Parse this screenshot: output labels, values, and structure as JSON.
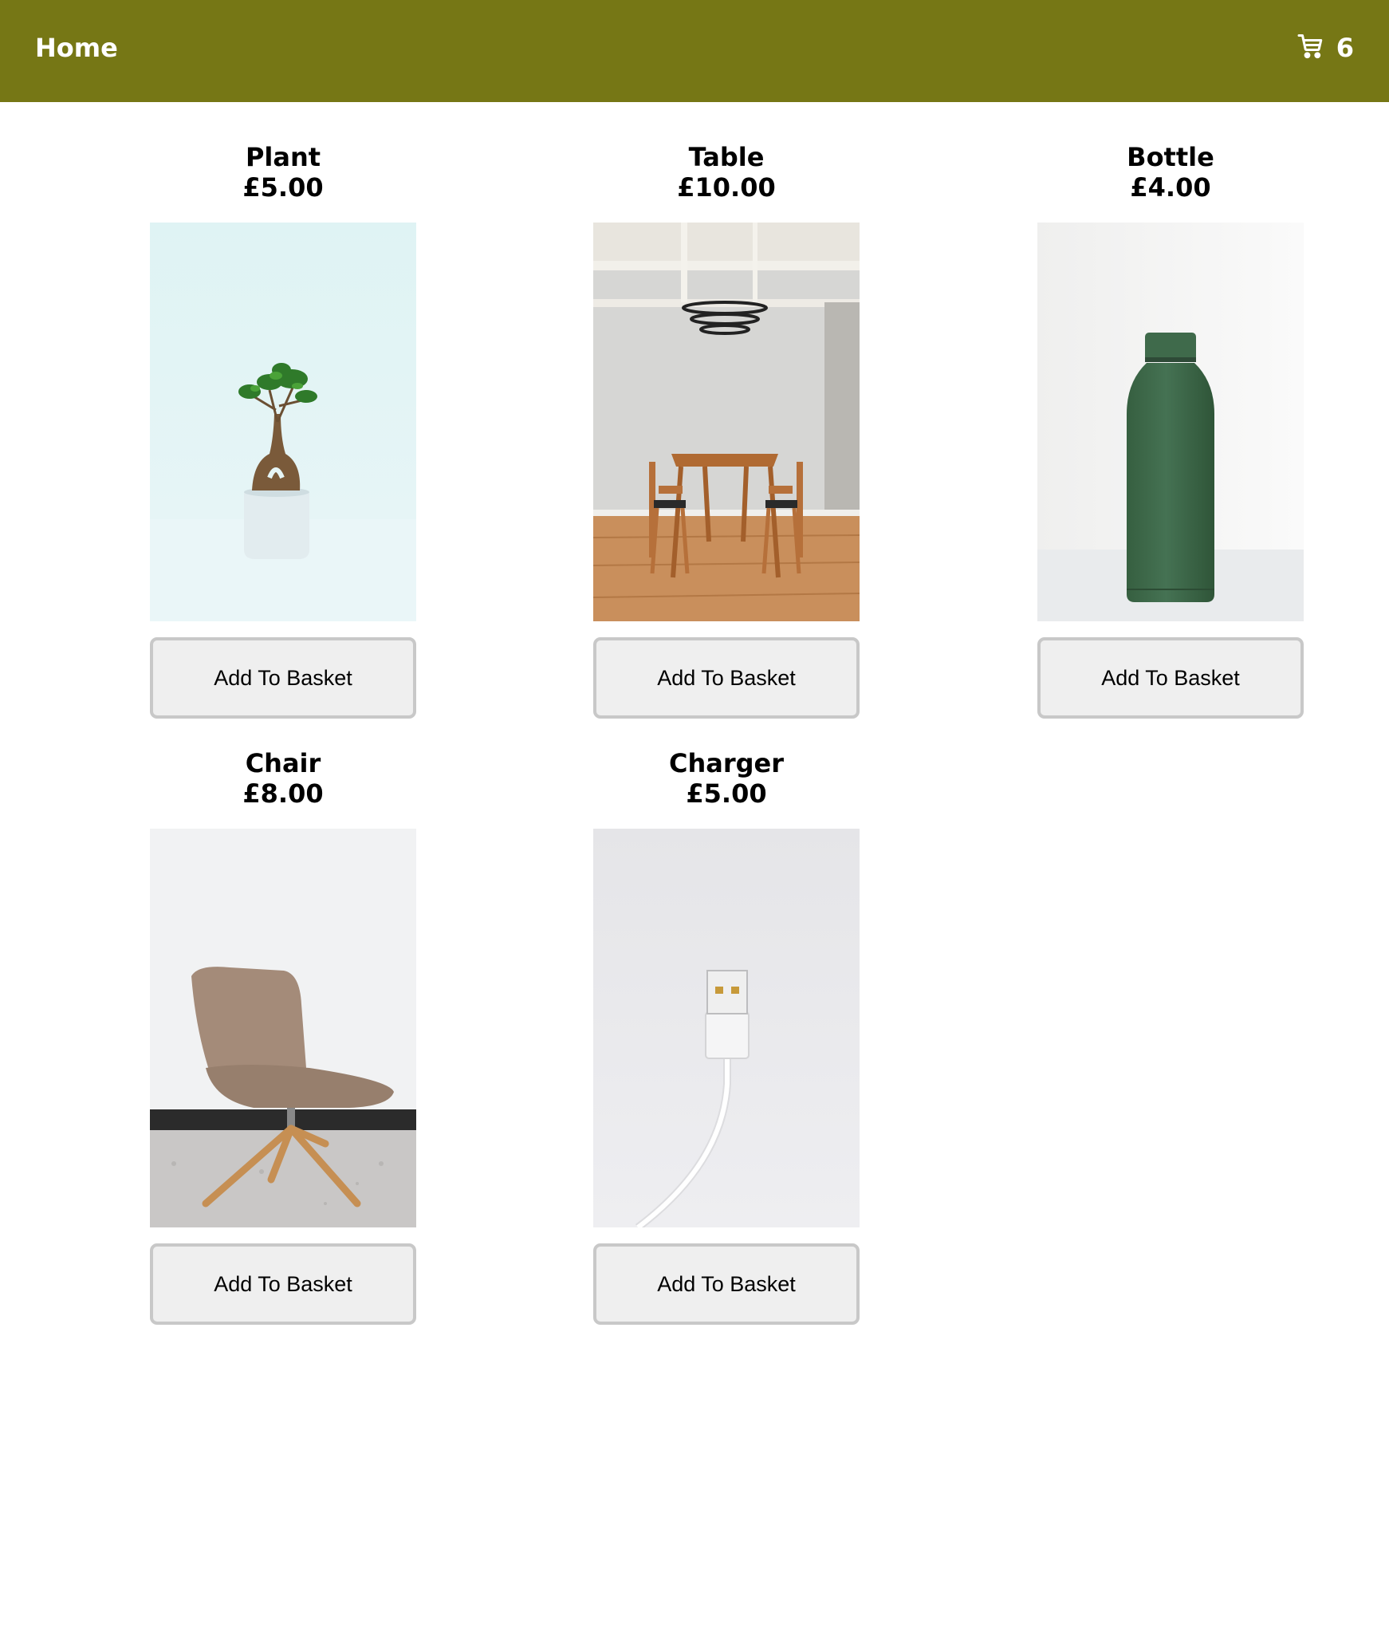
{
  "header": {
    "home_label": "Home",
    "cart_count": "6",
    "background_color": "#767715"
  },
  "products": [
    {
      "name": "Plant",
      "price": "£5.00",
      "button_label": "Add To Basket",
      "image": "bonsai-plant"
    },
    {
      "name": "Table",
      "price": "£10.00",
      "button_label": "Add To Basket",
      "image": "dining-table"
    },
    {
      "name": "Bottle",
      "price": "£4.00",
      "button_label": "Add To Basket",
      "image": "green-bottle"
    },
    {
      "name": "Chair",
      "price": "£8.00",
      "button_label": "Add To Basket",
      "image": "lounge-chair"
    },
    {
      "name": "Charger",
      "price": "£5.00",
      "button_label": "Add To Basket",
      "image": "usb-cable"
    }
  ]
}
